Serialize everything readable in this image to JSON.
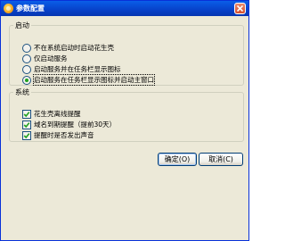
{
  "window": {
    "title": "参数配置",
    "close_glyph": "×"
  },
  "startup": {
    "legend": "启动",
    "options": [
      {
        "label": "不在系统启动时启动花生壳",
        "selected": false
      },
      {
        "label": "仅启动服务",
        "selected": false
      },
      {
        "label": "启动服务并在任务栏显示图标",
        "selected": false
      },
      {
        "label": "启动服务在任务栏显示图标并启动主窗口",
        "selected": true
      }
    ]
  },
  "system": {
    "legend": "系统",
    "options": [
      {
        "label": "花生壳离线提醒",
        "checked": true
      },
      {
        "label": "域名到期提醒（提前30天）",
        "checked": true
      },
      {
        "label": "提醒时是否发出声音",
        "checked": true
      }
    ]
  },
  "buttons": {
    "ok_label": "确定(O)",
    "cancel_label": "取消(C)"
  },
  "colors": {
    "titlebar": "#0a5ee8",
    "window_bg": "#ece9d8",
    "radio_dot": "#21a121",
    "check_mark": "#21a121"
  }
}
